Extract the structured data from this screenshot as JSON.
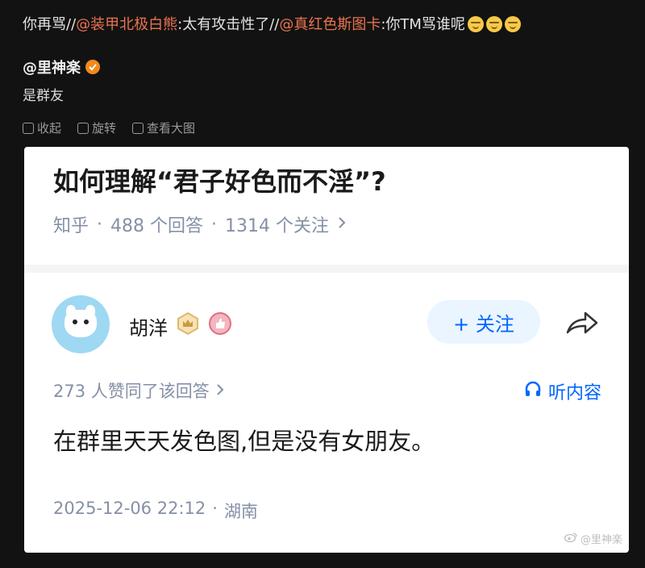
{
  "post": {
    "repost_segments": [
      {
        "text": "你再骂//",
        "mention": false
      },
      {
        "text": "@装甲北极白熊",
        "mention": true
      },
      {
        "text": ":太有攻击性了//",
        "mention": false
      },
      {
        "text": "@真红色斯图卡",
        "mention": true
      },
      {
        "text": ":你TM骂谁呢",
        "mention": false
      }
    ],
    "emoji_icons": [
      "grin-sweat-emoji",
      "grin-sweat-emoji",
      "grin-sweat-emoji"
    ],
    "author": "@里神楽",
    "author_badge_icon": "verified-orange-badge-icon",
    "comment": "是群友",
    "actions": [
      {
        "label": "收起",
        "icon": "collapse-icon"
      },
      {
        "label": "旋转",
        "icon": "rotate-icon"
      },
      {
        "label": "查看大图",
        "icon": "view-large-image-icon"
      }
    ]
  },
  "zhihu": {
    "question_title": "如何理解“君子好色而不淫”?",
    "meta": {
      "source": "知乎",
      "answers": "488 个回答",
      "follows": "1314 个关注"
    },
    "answer_author": "胡洋",
    "follow_label": "+ 关注",
    "votes_text": "273 人赞同了该回答",
    "listen_label": "听内容",
    "answer_text": "在群里天天发色图,但是没有女朋友。",
    "timestamp": "2025-12-06 22:12",
    "location": "湖南"
  },
  "watermark": "@里神楽",
  "colors": {
    "mention": "#eb7350",
    "zhihu_blue": "#0066ff",
    "meta_gray": "#8590a6"
  }
}
